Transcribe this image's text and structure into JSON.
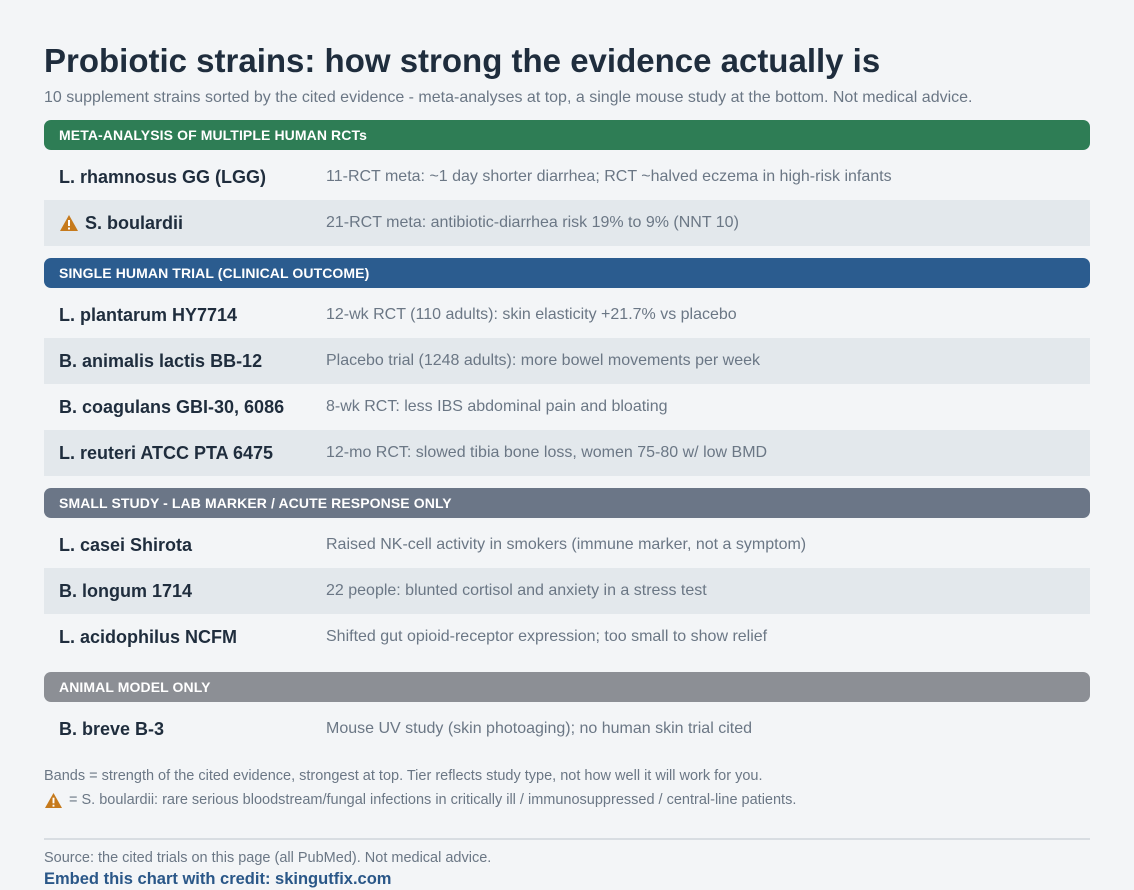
{
  "title": "Probiotic strains: how strong the evidence actually is",
  "subtitle": "10 supplement strains sorted by the cited evidence - meta-analyses at top, a single mouse study at the bottom. Not medical advice.",
  "colors": {
    "tier_meta": "#2e7d55",
    "tier_single": "#2b5c8f",
    "tier_small": "#6b7687",
    "tier_animal": "#8c8f95",
    "warning": "#c67a1c"
  },
  "chart_data": {
    "type": "table",
    "tiers": [
      {
        "label": "META-ANALYSIS OF MULTIPLE HUMAN RCTs",
        "rows": [
          {
            "strain": "L. rhamnosus GG (LGG)",
            "warning": false,
            "evidence": "11-RCT meta: ~1 day shorter diarrhea; RCT ~halved eczema in high-risk infants"
          },
          {
            "strain": "S. boulardii",
            "warning": true,
            "evidence": "21-RCT meta: antibiotic-diarrhea risk 19% to 9% (NNT 10)"
          }
        ]
      },
      {
        "label": "SINGLE HUMAN TRIAL (CLINICAL OUTCOME)",
        "rows": [
          {
            "strain": "L. plantarum HY7714",
            "warning": false,
            "evidence": "12-wk RCT (110 adults): skin elasticity +21.7% vs placebo"
          },
          {
            "strain": "B. animalis lactis BB-12",
            "warning": false,
            "evidence": "Placebo trial (1248 adults): more bowel movements per week"
          },
          {
            "strain": "B. coagulans GBI-30, 6086",
            "warning": false,
            "evidence": "8-wk RCT: less IBS abdominal pain and bloating"
          },
          {
            "strain": "L. reuteri ATCC PTA 6475",
            "warning": false,
            "evidence": "12-mo RCT: slowed tibia bone loss, women 75-80 w/ low BMD"
          }
        ]
      },
      {
        "label": "SMALL STUDY - LAB MARKER / ACUTE RESPONSE ONLY",
        "rows": [
          {
            "strain": "L. casei Shirota",
            "warning": false,
            "evidence": "Raised NK-cell activity in smokers (immune marker, not a symptom)"
          },
          {
            "strain": "B. longum 1714",
            "warning": false,
            "evidence": "22 people: blunted cortisol and anxiety in a stress test"
          },
          {
            "strain": "L. acidophilus NCFM",
            "warning": false,
            "evidence": "Shifted gut opioid-receptor expression; too small to show relief"
          }
        ]
      },
      {
        "label": "ANIMAL MODEL ONLY",
        "rows": [
          {
            "strain": "B. breve B-3",
            "warning": false,
            "evidence": "Mouse UV study (skin photoaging); no human skin trial cited"
          }
        ]
      }
    ]
  },
  "notes": {
    "bands": "Bands = strength of the cited evidence, strongest at top. Tier reflects study type, not how well it will work for you.",
    "warning": "= S. boulardii: rare serious bloodstream/fungal infections in critically ill / immunosuppressed / central-line patients."
  },
  "footer": {
    "source": "Source: the cited trials on this page (all PubMed). Not medical advice.",
    "credit": "Embed this chart with credit: skingutfix.com"
  },
  "icons": {
    "warning": "warning-triangle-icon"
  }
}
